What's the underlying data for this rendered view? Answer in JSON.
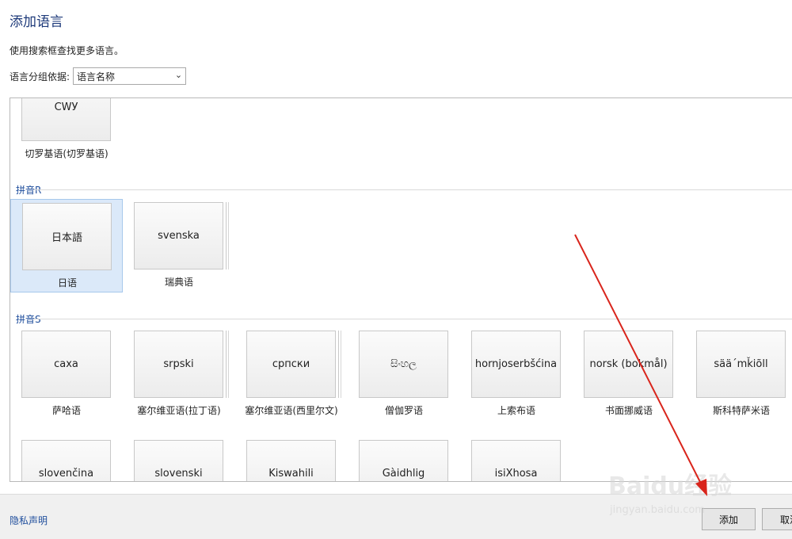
{
  "dialog": {
    "title": "添加语言",
    "hint": "使用搜索框查找更多语言。",
    "group_label": "语言分组依据:",
    "group_select": "语言名称"
  },
  "languages": {
    "top": {
      "native": "CWУ",
      "name": "切罗基语(切罗基语)"
    },
    "section_r": {
      "header": "拼音R",
      "items": [
        {
          "native": "日本語",
          "name": "日语"
        },
        {
          "native": "svenska",
          "name": "瑞典语"
        }
      ]
    },
    "section_s": {
      "header": "拼音S",
      "items": [
        {
          "native": "саха",
          "name": "萨哈语"
        },
        {
          "native": "srpski",
          "name": "塞尔维亚语(拉丁语)"
        },
        {
          "native": "српски",
          "name": "塞尔维亚语(西里尔文)"
        },
        {
          "native": "සිංහල",
          "name": "僧伽罗语"
        },
        {
          "native": "hornjoserbšćina",
          "name": "上索布语"
        },
        {
          "native": "norsk (bokmål)",
          "name": "书面挪威语"
        },
        {
          "native": "sää´mǩiõll",
          "name": "斯科特萨米语"
        }
      ],
      "row2": [
        {
          "native": "slovenčina"
        },
        {
          "native": "slovenski"
        },
        {
          "native": "Kiswahili"
        },
        {
          "native": "Gàidhlig"
        },
        {
          "native": "isiXhosa"
        }
      ]
    }
  },
  "footer": {
    "privacy": "隐私声明",
    "add": "添加",
    "cancel": "取消"
  },
  "watermark": {
    "main": "Baidu经验",
    "sub": "jingyan.baidu.com"
  },
  "colors": {
    "accent": "#1e4d9c",
    "selected_bg": "#dbe9f9",
    "arrow": "#d9251c"
  }
}
